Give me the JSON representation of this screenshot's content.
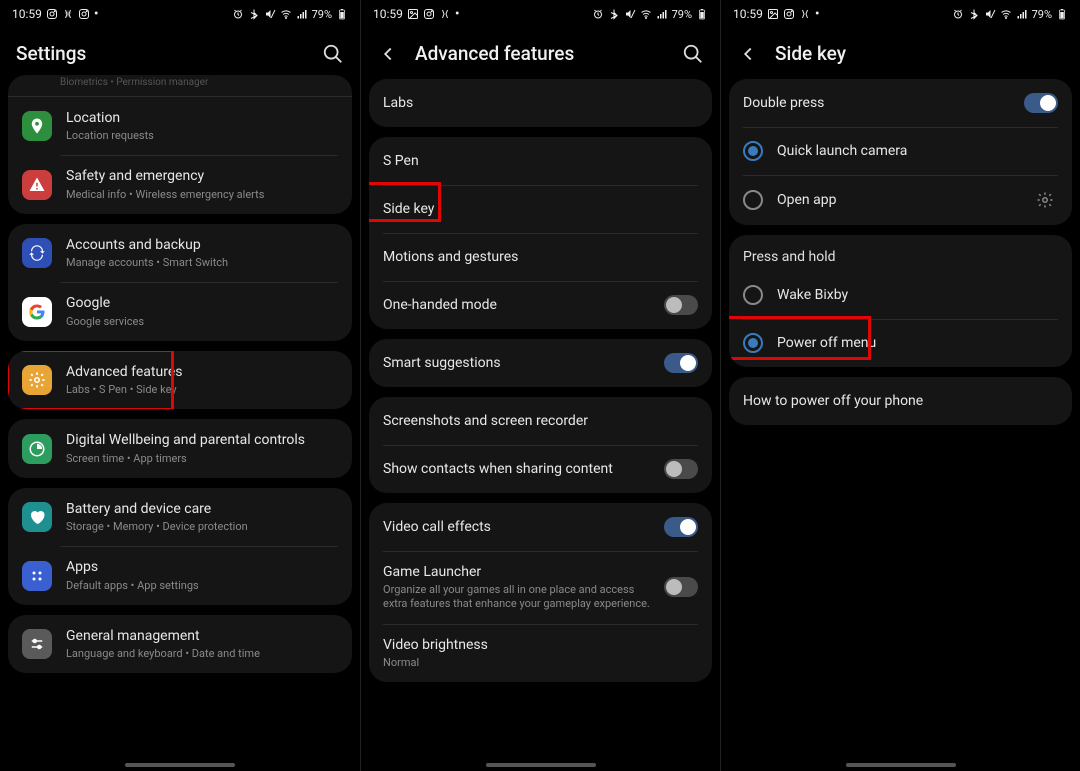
{
  "status": {
    "time": "10:59",
    "battery_pct": "79%"
  },
  "screens": [
    {
      "header": {
        "title": "Settings",
        "back": false,
        "search": true
      },
      "groups": [
        {
          "peek": "Biometrics  •  Permission manager",
          "items": [
            {
              "icon": "location",
              "bg": "#2d8f3e",
              "title": "Location",
              "subtitle": "Location requests"
            },
            {
              "icon": "alert",
              "bg": "#cc3d3d",
              "title": "Safety and emergency",
              "subtitle": "Medical info  •  Wireless emergency alerts"
            }
          ]
        },
        {
          "items": [
            {
              "icon": "sync",
              "bg": "#2e4fb5",
              "title": "Accounts and backup",
              "subtitle": "Manage accounts  •  Smart Switch"
            },
            {
              "icon": "google",
              "bg": "#fff",
              "title": "Google",
              "subtitle": "Google services"
            }
          ]
        },
        {
          "highlight": true,
          "items": [
            {
              "icon": "gear",
              "bg": "#e8a434",
              "title": "Advanced features",
              "subtitle": "Labs  •  S Pen  •  Side key"
            }
          ]
        },
        {
          "items": [
            {
              "icon": "wellbeing",
              "bg": "#2d9c5f",
              "title": "Digital Wellbeing and parental controls",
              "subtitle": "Screen time  •  App timers"
            }
          ]
        },
        {
          "items": [
            {
              "icon": "care",
              "bg": "#1e9090",
              "title": "Battery and device care",
              "subtitle": "Storage  •  Memory  •  Device protection"
            },
            {
              "icon": "apps",
              "bg": "#3a5fd0",
              "title": "Apps",
              "subtitle": "Default apps  •  App settings"
            }
          ]
        },
        {
          "items": [
            {
              "icon": "sliders",
              "bg": "#5a5a5a",
              "title": "General management",
              "subtitle": "Language and keyboard  •  Date and time"
            }
          ]
        }
      ]
    },
    {
      "header": {
        "title": "Advanced features",
        "back": true,
        "search": true
      },
      "groups": [
        {
          "items": [
            {
              "title": "Labs"
            }
          ]
        },
        {
          "items": [
            {
              "title": "S Pen"
            },
            {
              "title": "Side key",
              "highlight": true
            },
            {
              "title": "Motions and gestures"
            },
            {
              "title": "One-handed mode",
              "toggle": "off"
            }
          ]
        },
        {
          "items": [
            {
              "title": "Smart suggestions",
              "toggle": "on"
            }
          ]
        },
        {
          "items": [
            {
              "title": "Screenshots and screen recorder"
            },
            {
              "title": "Show contacts when sharing content",
              "toggle": "off"
            }
          ]
        },
        {
          "items": [
            {
              "title": "Video call effects",
              "toggle": "on"
            },
            {
              "title": "Game Launcher",
              "subtitle": "Organize all your games all in one place and access extra features that enhance your gameplay experience.",
              "toggle": "off"
            },
            {
              "title": "Video brightness",
              "subtitle": "Normal"
            }
          ]
        }
      ]
    },
    {
      "header": {
        "title": "Side key",
        "back": true,
        "search": false
      },
      "groups": [
        {
          "section": "Double press",
          "section_toggle": "on",
          "items": [
            {
              "radio": "sel",
              "title": "Quick launch camera"
            },
            {
              "radio": "unsel",
              "title": "Open app",
              "gear": true
            }
          ]
        },
        {
          "section": "Press and hold",
          "items": [
            {
              "radio": "unsel",
              "title": "Wake Bixby"
            },
            {
              "radio": "sel",
              "title": "Power off menu",
              "highlight": true
            }
          ]
        },
        {
          "items": [
            {
              "title": "How to power off your phone"
            }
          ]
        }
      ]
    }
  ]
}
